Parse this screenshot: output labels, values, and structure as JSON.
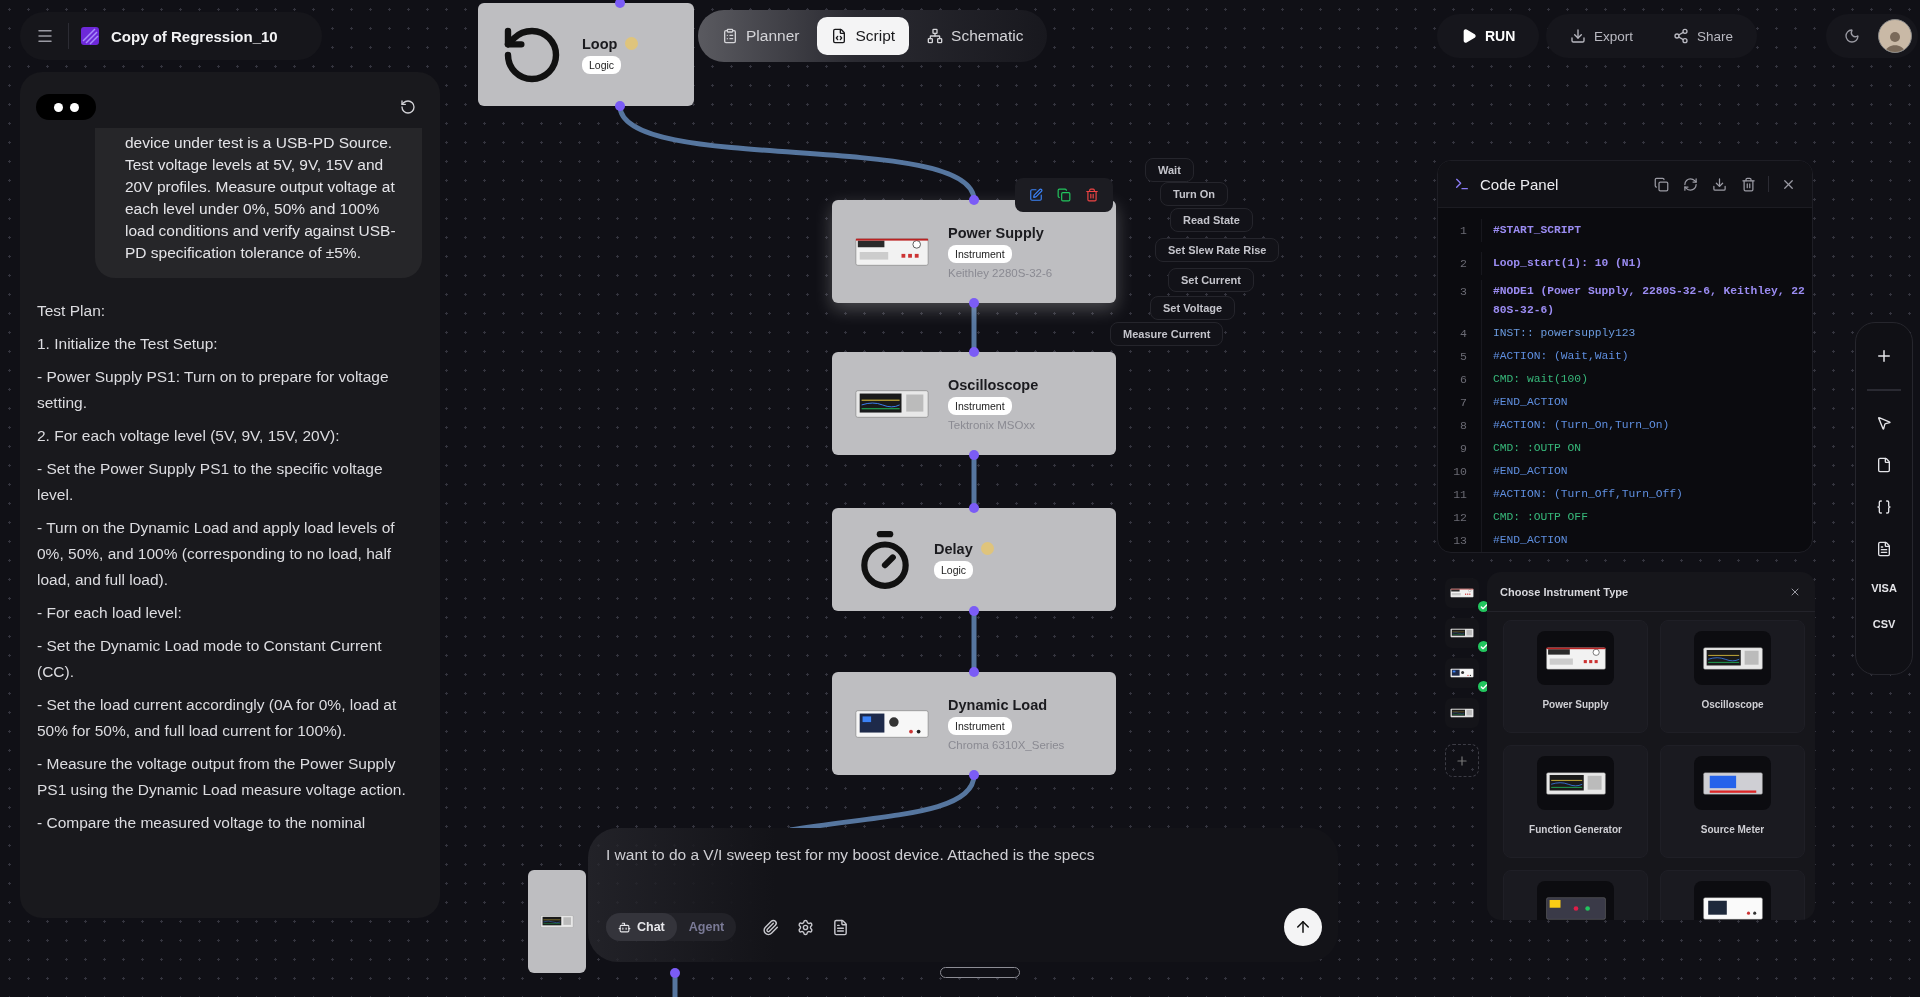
{
  "header": {
    "title": "Copy of Regression_10"
  },
  "view_tabs": [
    {
      "label": "Planner",
      "kind": "planner",
      "selected": false
    },
    {
      "label": "Script",
      "kind": "script",
      "selected": true
    },
    {
      "label": "Schematic",
      "kind": "schematic",
      "selected": false
    }
  ],
  "actions": {
    "run": "RUN",
    "export": "Export",
    "share": "Share"
  },
  "chat": {
    "user_message": "device under test is a USB-PD Source. Test voltage levels at 5V, 9V, 15V and 20V profiles. Measure output voltage at each level under 0%, 50% and 100% load conditions and verify against USB-PD specification tolerance of ±5%.",
    "plan": [
      "Test Plan:",
      "1. Initialize the Test Setup:",
      "- Power Supply PS1: Turn on to prepare for voltage setting.",
      "2. For each voltage level (5V, 9V, 15V, 20V):",
      "- Set the Power Supply PS1 to the specific voltage level.",
      "- Turn on the Dynamic Load and apply load levels of 0%, 50%, and 100% (corresponding to no load, half load, and full load).",
      "- For each load level:",
      "- Set the Dynamic Load mode to Constant Current (CC).",
      "- Set the load current accordingly (0A for 0%, load at 50% for 50%, and full load current for 100%).",
      "- Measure the voltage output from the Power Supply PS1 using the Dynamic Load measure voltage action.",
      "- Compare the measured voltage to the nominal"
    ]
  },
  "canvas": {
    "nodes": [
      {
        "kind": "loop",
        "title": "Loop",
        "tag": "Logic",
        "warning": true,
        "selected": false
      },
      {
        "kind": "power_supply",
        "title": "Power Supply",
        "tag": "Instrument",
        "model": "Keithley 2280S-32-6",
        "warning": false,
        "selected": true
      },
      {
        "kind": "oscilloscope",
        "title": "Oscilloscope",
        "tag": "Instrument",
        "model": "Tektronix MSOxx",
        "warning": false,
        "selected": false
      },
      {
        "kind": "delay",
        "title": "Delay",
        "tag": "Logic",
        "warning": true,
        "selected": false
      },
      {
        "kind": "dynamic_load",
        "title": "Dynamic Load",
        "tag": "Instrument",
        "model": "Chroma 6310X_Series",
        "warning": false,
        "selected": false
      },
      {
        "kind": "oscilloscope",
        "warning": false,
        "selected": false
      }
    ],
    "node_actions": [
      "Wait",
      "Turn On",
      "Read State",
      "Set Slew Rate Rise",
      "Set Current",
      "Set Voltage",
      "Measure Current"
    ]
  },
  "code_panel": {
    "title": "Code Panel",
    "lines": [
      {
        "number": "1",
        "kind": "header",
        "text": "#START_SCRIPT"
      },
      {
        "number": "2",
        "kind": "header",
        "text": "Loop_start(1): 10 (N1)"
      },
      {
        "number": "3",
        "kind": "header",
        "text": "#NODE1 (Power Supply, 2280S-32-6, Keithley, 2280S-32-6)"
      },
      {
        "number": "4",
        "kind": "inst",
        "text": "INST:: powersupply123"
      },
      {
        "number": "5",
        "kind": "directive",
        "text": "#ACTION: (Wait,Wait)"
      },
      {
        "number": "6",
        "kind": "command",
        "text": "CMD: wait(100)"
      },
      {
        "number": "7",
        "kind": "directive",
        "text": "#END_ACTION"
      },
      {
        "number": "8",
        "kind": "directive",
        "text": "#ACTION: (Turn_On,Turn_On)"
      },
      {
        "number": "9",
        "kind": "command",
        "text": "CMD: :OUTP ON"
      },
      {
        "number": "10",
        "kind": "directive",
        "text": "#END_ACTION"
      },
      {
        "number": "11",
        "kind": "directive",
        "text": "#ACTION: (Turn_Off,Turn_Off)"
      },
      {
        "number": "12",
        "kind": "command",
        "text": "CMD: :OUTP OFF"
      },
      {
        "number": "13",
        "kind": "directive",
        "text": "#END_ACTION"
      }
    ]
  },
  "side_tools": [
    "VISA",
    "CSV"
  ],
  "instrument_slots": [
    {
      "kind": "power_supply",
      "connected": true
    },
    {
      "kind": "oscilloscope",
      "connected": true
    },
    {
      "kind": "dynamic_load",
      "connected": true
    },
    {
      "kind": "oscilloscope",
      "connected": false
    }
  ],
  "instrument_picker": {
    "title": "Choose Instrument Type",
    "options": [
      {
        "kind": "power_supply",
        "label": "Power Supply"
      },
      {
        "kind": "oscilloscope",
        "label": "Oscilloscope"
      },
      {
        "kind": "function_generator",
        "label": "Function Generator"
      },
      {
        "kind": "source_meter",
        "label": "Source Meter"
      },
      {
        "kind": "panel_unit"
      },
      {
        "kind": "bench_unit"
      }
    ]
  },
  "chat_input": {
    "value": "I want to do a V/I sweep test for my boost device. Attached is the specs",
    "modes": [
      {
        "label": "Chat",
        "selected": true,
        "disabled": false
      },
      {
        "label": "Agent",
        "selected": false,
        "disabled": true
      }
    ]
  }
}
